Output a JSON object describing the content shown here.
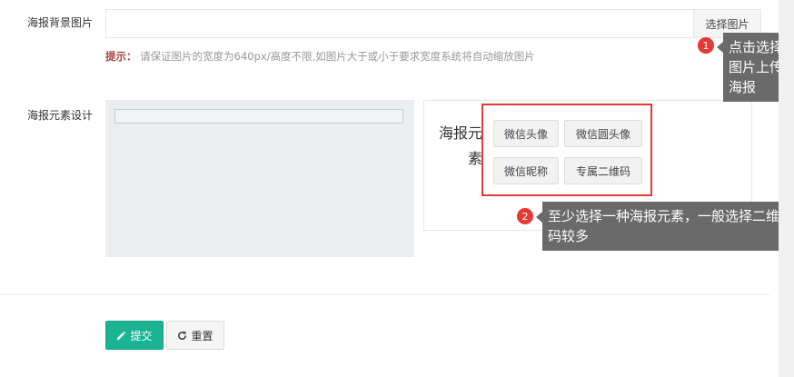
{
  "form": {
    "bg_image_label": "海报背景图片",
    "pick_image_button": "选择图片",
    "hint_key": "提示：",
    "hint_text": "请保证图片的宽度为640px/高度不限,如图片大于或小于要求宽度系统将自动缩放图片",
    "design_label": "海报元素设计",
    "elements_title": "海报元素",
    "elements": [
      "微信头像",
      "微信圆头像",
      "微信昵称",
      "专属二维码"
    ],
    "submit_label": "提交",
    "reset_label": "重置"
  },
  "annotations": {
    "tip1_number": "1",
    "tip1_text": "点击选择图片上传海报",
    "tip2_number": "2",
    "tip2_text": "至少选择一种海报元素，一般选择二维码较多"
  },
  "icons": {
    "submit": "pencil-icon",
    "reset": "refresh-icon"
  },
  "colors": {
    "primary": "#1ab394",
    "highlight": "#e53935",
    "hint_key": "#a94442",
    "tooltip": "#6a6a6a"
  }
}
